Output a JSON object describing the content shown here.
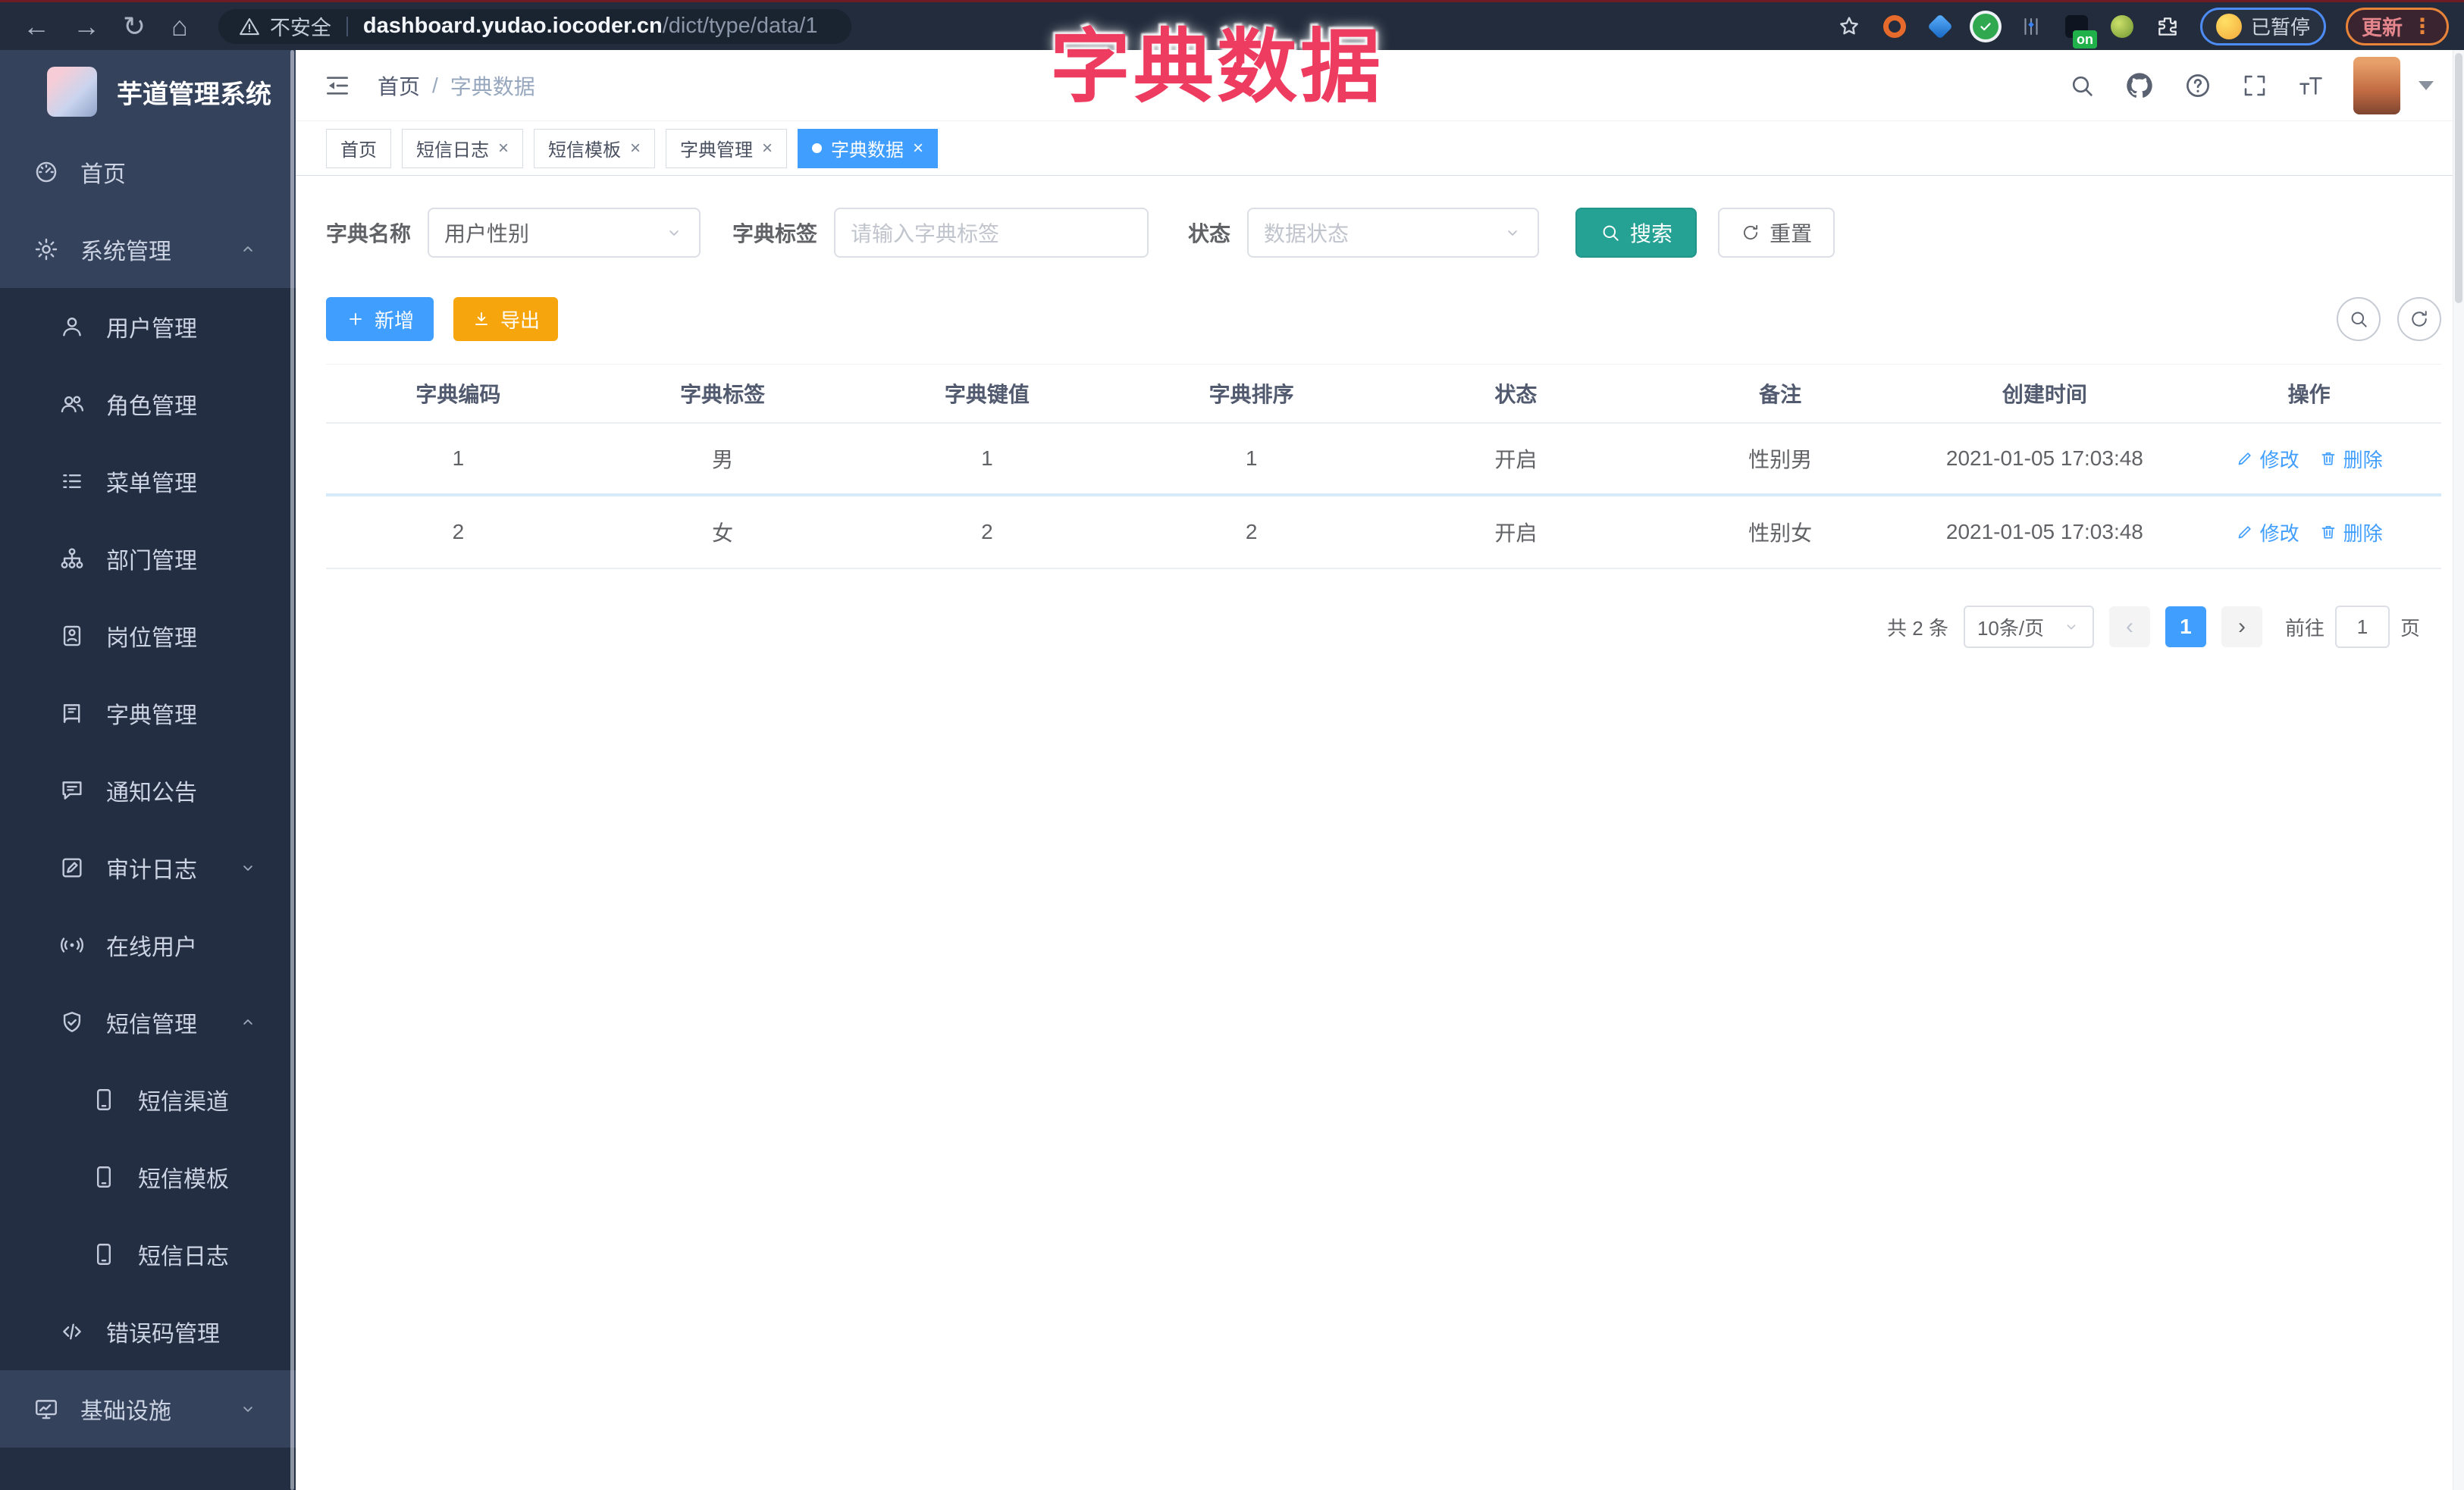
{
  "colors": {
    "accent_blue": "#409eff",
    "search_teal": "#26a295",
    "export_orange": "#f6a50d",
    "sidebar_dark": "#232e42",
    "sidebar_light": "#35425c",
    "annotation_red": "#ee3c61"
  },
  "overlay_title": "字典数据",
  "browser": {
    "security_label": "不安全",
    "url_host": "dashboard.yudao.iocoder.cn",
    "url_path": "/dict/type/data/1",
    "extension_on_badge": "on",
    "paused_label": "已暂停",
    "update_label": "更新",
    "menu_dots": "⋮"
  },
  "sidebar": {
    "logo_title": "芋道管理系统",
    "items": [
      {
        "name": "home",
        "label": "首页",
        "icon": "dashboard",
        "level": 1,
        "bg": "light"
      },
      {
        "name": "system-management",
        "label": "系统管理",
        "icon": "gear",
        "level": 1,
        "bg": "light",
        "chevron": "up"
      },
      {
        "name": "user-management",
        "label": "用户管理",
        "icon": "user",
        "level": 2,
        "bg": "dark"
      },
      {
        "name": "role-management",
        "label": "角色管理",
        "icon": "users",
        "level": 2,
        "bg": "dark"
      },
      {
        "name": "menu-management",
        "label": "菜单管理",
        "icon": "menu-list",
        "level": 2,
        "bg": "dark"
      },
      {
        "name": "dept-management",
        "label": "部门管理",
        "icon": "org-tree",
        "level": 2,
        "bg": "dark"
      },
      {
        "name": "post-management",
        "label": "岗位管理",
        "icon": "badge",
        "level": 2,
        "bg": "dark"
      },
      {
        "name": "dict-management",
        "label": "字典管理",
        "icon": "dict-book",
        "level": 2,
        "bg": "dark"
      },
      {
        "name": "notice",
        "label": "通知公告",
        "icon": "notice",
        "level": 2,
        "bg": "dark"
      },
      {
        "name": "audit-log",
        "label": "审计日志",
        "icon": "audit-log",
        "level": 2,
        "bg": "dark",
        "chevron": "down"
      },
      {
        "name": "online-user",
        "label": "在线用户",
        "icon": "online",
        "level": 2,
        "bg": "dark"
      },
      {
        "name": "sms-management",
        "label": "短信管理",
        "icon": "shield-check",
        "level": 2,
        "bg": "dark",
        "chevron": "up"
      },
      {
        "name": "sms-channel",
        "label": "短信渠道",
        "icon": "phone",
        "level": 3,
        "bg": "dark"
      },
      {
        "name": "sms-template",
        "label": "短信模板",
        "icon": "phone",
        "level": 3,
        "bg": "dark"
      },
      {
        "name": "sms-log",
        "label": "短信日志",
        "icon": "phone",
        "level": 3,
        "bg": "dark"
      },
      {
        "name": "error-code",
        "label": "错误码管理",
        "icon": "code",
        "level": 2,
        "bg": "dark"
      },
      {
        "name": "infrastructure",
        "label": "基础设施",
        "icon": "monitor",
        "level": 1,
        "bg": "light",
        "chevron": "down"
      }
    ]
  },
  "navbar": {
    "breadcrumb": {
      "home": "首页",
      "separator": "/",
      "current": "字典数据"
    }
  },
  "tabs": [
    {
      "name": "tab-home",
      "label": "首页",
      "closable": false,
      "active": false
    },
    {
      "name": "tab-sms-log",
      "label": "短信日志",
      "closable": true,
      "active": false
    },
    {
      "name": "tab-sms-template",
      "label": "短信模板",
      "closable": true,
      "active": false
    },
    {
      "name": "tab-dict-management",
      "label": "字典管理",
      "closable": true,
      "active": false
    },
    {
      "name": "tab-dict-data",
      "label": "字典数据",
      "closable": true,
      "active": true
    }
  ],
  "filters": {
    "dict_name_label": "字典名称",
    "dict_name_value": "用户性别",
    "dict_label_label": "字典标签",
    "dict_label_placeholder": "请输入字典标签",
    "status_label": "状态",
    "status_placeholder": "数据状态",
    "search_label": "搜索",
    "reset_label": "重置"
  },
  "toolbar": {
    "add_label": "新增",
    "export_label": "导出"
  },
  "table": {
    "columns": [
      {
        "key": "code",
        "label": "字典编码"
      },
      {
        "key": "label",
        "label": "字典标签"
      },
      {
        "key": "value",
        "label": "字典键值"
      },
      {
        "key": "sort",
        "label": "字典排序"
      },
      {
        "key": "status",
        "label": "状态"
      },
      {
        "key": "remark",
        "label": "备注"
      },
      {
        "key": "created",
        "label": "创建时间"
      },
      {
        "key": "ops",
        "label": "操作"
      }
    ],
    "rows": [
      {
        "code": "1",
        "label": "男",
        "value": "1",
        "sort": "1",
        "status": "开启",
        "remark": "性别男",
        "created": "2021-01-05 17:03:48"
      },
      {
        "code": "2",
        "label": "女",
        "value": "2",
        "sort": "2",
        "status": "开启",
        "remark": "性别女",
        "created": "2021-01-05 17:03:48"
      }
    ],
    "edit_label": "修改",
    "delete_label": "删除"
  },
  "pagination": {
    "total_label": "共 2 条",
    "page_size": "10条/页",
    "current_page": "1",
    "goto_label": "前往",
    "goto_value": "1",
    "page_unit": "页"
  }
}
